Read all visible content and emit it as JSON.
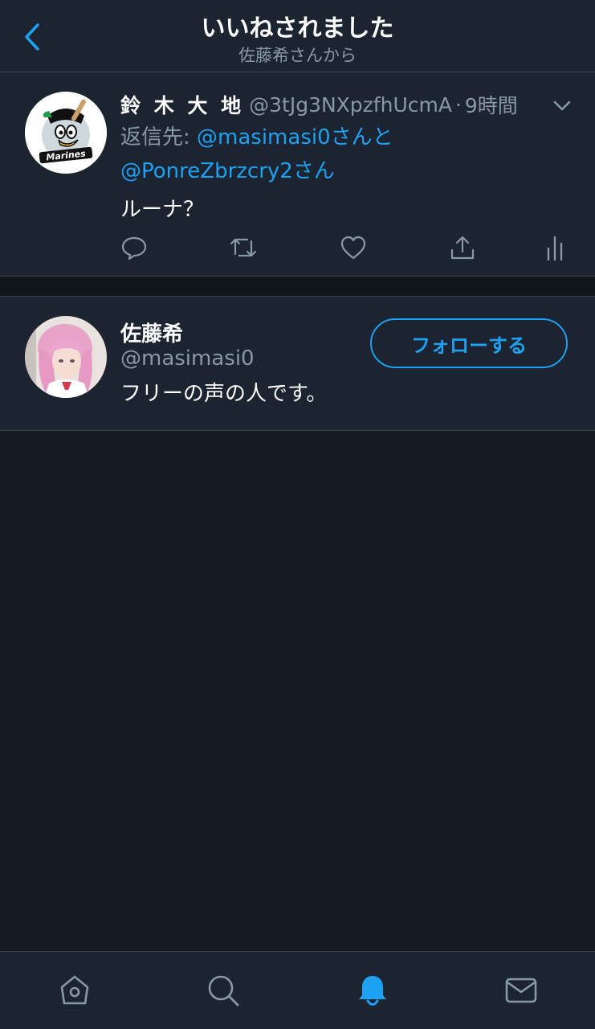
{
  "header": {
    "title": "いいねされました",
    "subtitle": "佐藤希さんから"
  },
  "tweet": {
    "author_name": "鈴 木 大 地",
    "author_handle": "@3tJg3NXpzfhUcmA",
    "separator": "·",
    "time": "9時間",
    "reply_prefix": "返信先: ",
    "mention1": "@masimasi0",
    "reply_and": "さんと",
    "mention2": "@PonreZbrzcry2",
    "reply_suffix": "さん",
    "text": "ルーナ？",
    "avatar_text": "Marines"
  },
  "user": {
    "name": "佐藤希",
    "handle": "@masimasi0",
    "bio": "フリーの声の人です。",
    "follow_label": "フォローする"
  },
  "colors": {
    "accent": "#1da1f2",
    "background": "#141922",
    "card": "#1b2430",
    "secondary_text": "#8899a6"
  },
  "icons": {
    "back": "chevron-left-icon",
    "caret": "chevron-down-icon",
    "reply": "reply-icon",
    "retweet": "retweet-icon",
    "like": "heart-icon",
    "share": "share-icon",
    "analytics": "analytics-icon",
    "home": "home-icon",
    "search": "search-icon",
    "notifications": "bell-icon",
    "messages": "mail-icon"
  }
}
